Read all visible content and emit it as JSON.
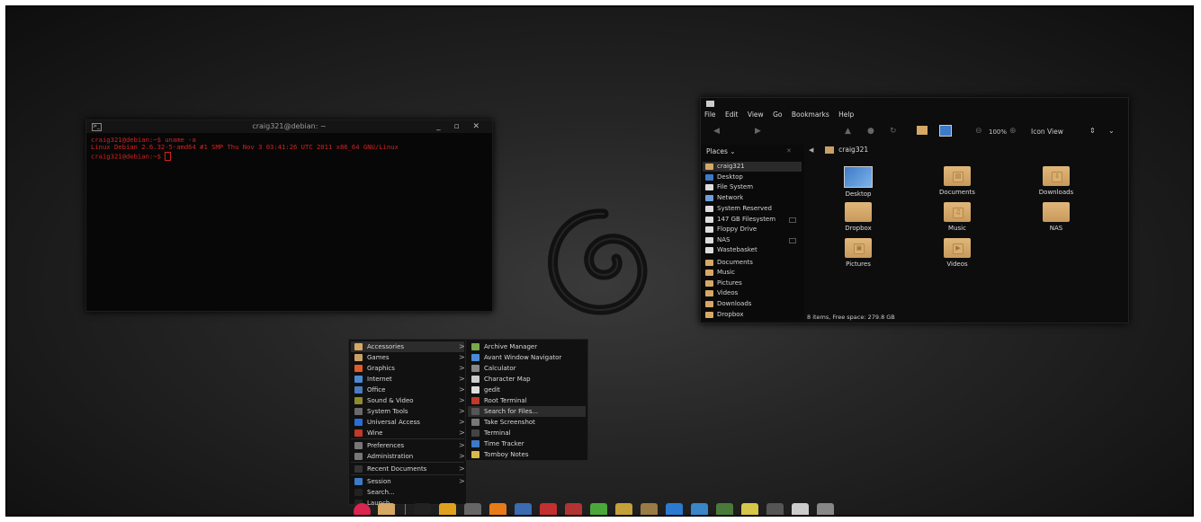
{
  "terminal": {
    "title": "craig321@debian: ~",
    "buttons": "_ ▫ ✕",
    "lines": [
      "craig321@debian:~$ uname -a",
      "Linux Debian 2.6.32-5-amd64 #1 SMP Thu Nov 3 03:41:26 UTC 2011 x86_64 GNU/Linux",
      "craig321@debian:~$ "
    ]
  },
  "filemanager": {
    "menus": [
      "File",
      "Edit",
      "View",
      "Go",
      "Bookmarks",
      "Help"
    ],
    "zoom": "100%",
    "view_mode": "Icon View",
    "places_label": "Places",
    "path": "craig321",
    "sidebar": [
      "craig321",
      "Desktop",
      "File System",
      "Network",
      "System Reserved",
      "147 GB Filesystem",
      "Floppy Drive",
      "NAS",
      "Wastebasket",
      "Documents",
      "Music",
      "Pictures",
      "Videos",
      "Downloads",
      "Dropbox"
    ],
    "items": [
      "Desktop",
      "Documents",
      "Downloads",
      "Dropbox",
      "Music",
      "NAS",
      "Pictures",
      "Videos"
    ],
    "status": "8 items, Free space: 279.8 GB"
  },
  "menu": {
    "categories": [
      "Accessories",
      "Games",
      "Graphics",
      "Internet",
      "Office",
      "Sound & Video",
      "System Tools",
      "Universal Access",
      "Wine",
      "Preferences",
      "Administration",
      "Recent Documents",
      "Session",
      "Search...",
      "Launch..."
    ],
    "apps": [
      "Archive Manager",
      "Avant Window Navigator",
      "Calculator",
      "Character Map",
      "gedit",
      "Root Terminal",
      "Search for Files...",
      "Take Screenshot",
      "Terminal",
      "Time Tracker",
      "Tomboy Notes"
    ]
  },
  "dock": {
    "icons": [
      "debian-icon",
      "folder-icon",
      "terminal-icon",
      "chrome-icon",
      "disk-utility-icon",
      "vlc-icon",
      "xbmc-icon",
      "screenshot-icon",
      "media-icon",
      "calculator-icon",
      "image-editor-icon",
      "text-editor-icon",
      "blender-icon",
      "monitor-icon",
      "system-monitor-icon",
      "notes-icon",
      "disk-icon",
      "archive-icon",
      "trash-icon"
    ]
  }
}
